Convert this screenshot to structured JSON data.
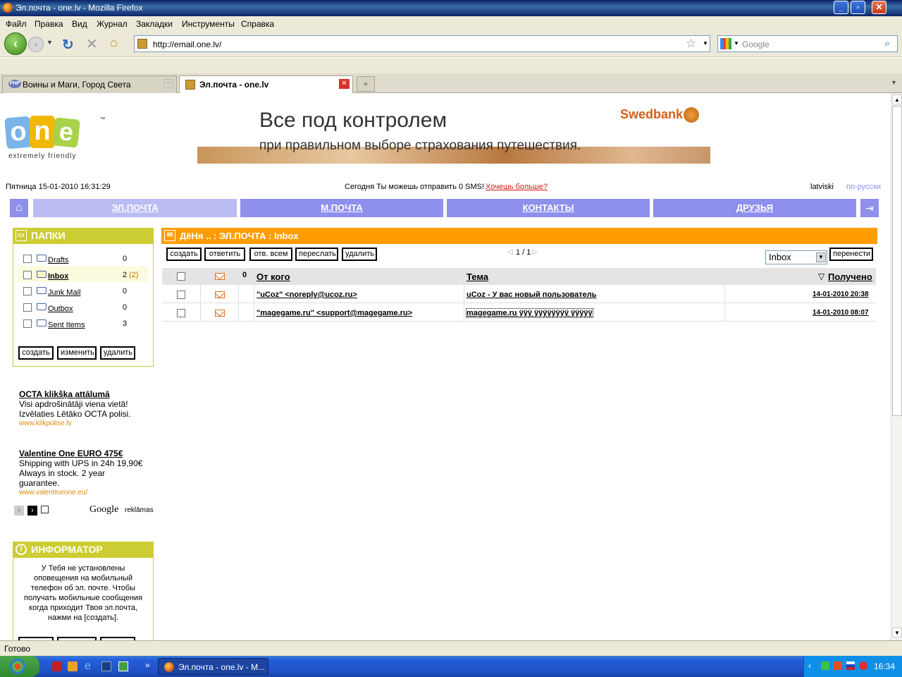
{
  "window": {
    "title": "Эл.почта - one.lv - Mozilla Firefox"
  },
  "menu": [
    "Файл",
    "Правка",
    "Вид",
    "Журнал",
    "Закладки",
    "Инструменты",
    "Справка"
  ],
  "nav": {
    "url": "http://email.one.lv/",
    "search_placeholder": "Google"
  },
  "tabs": [
    {
      "label": "Воины и Маги, Город Света",
      "icon": "php-icon"
    },
    {
      "label": "Эл.почта - one.lv",
      "icon": "page-icon"
    }
  ],
  "banner": {
    "logo": "one",
    "logo_tagline": "extremely friendly",
    "headline": "Все под контролем",
    "subline": "при правильном выборе страхования путешествия.",
    "brand": "Swedbank"
  },
  "infobar": {
    "datetime": "Пятница 15-01-2010 16:31:29",
    "sms_text": "Сегодня Ты можешь отправить 0 SMS!",
    "sms_link": "Хочешь больше?",
    "lang1": "latviski",
    "lang2": "по-русски"
  },
  "navtabs": [
    "ЭЛ.ПОЧТА",
    "М.ПОЧТА",
    "КОНТАКТЫ",
    "ДРУЗЬЯ"
  ],
  "folders_panel": {
    "title": "ПАПКИ",
    "items": [
      {
        "name": "Drafts",
        "count": "0",
        "unread": ""
      },
      {
        "name": "Inbox",
        "count": "2",
        "unread": "(2)"
      },
      {
        "name": "Junk Mail",
        "count": "0",
        "unread": ""
      },
      {
        "name": "Outbox",
        "count": "0",
        "unread": ""
      },
      {
        "name": "Sent Items",
        "count": "3",
        "unread": ""
      }
    ],
    "buttons": [
      "создать",
      "изменить",
      "удалить"
    ]
  },
  "ads": [
    {
      "title": "OCTA klikšķa attālumā",
      "line1": "Visi apdrošinātāji viena vietā!",
      "line2": "Izvēlaties Lētāko OCTA polisi.",
      "url": "www.klikpolise.lv"
    },
    {
      "title": "Valentine One EURO 475€",
      "line1": "Shipping with UPS in 24h 19,90€",
      "line2": "Always in stock. 2 year",
      "line3": "guarantee.",
      "url": "www.valentineone.eu/"
    }
  ],
  "ads_footer": {
    "google": "Google",
    "reklamas": "reklāmas"
  },
  "informer": {
    "title": "ИНФОРМАТОР",
    "text1": "У Тебя не установлены",
    "text2": "оповещения на мобильный",
    "text3": "телефон об эл. почте. Чтобы",
    "text4": "получать мобильные сообщения",
    "text5": "когда приходит Твоя эл.почта,",
    "text6": "нажми на [создать]."
  },
  "mail": {
    "header": "ДёНя .. : ЭЛ.ПОЧТА : Inbox",
    "toolbar": [
      "создать",
      "ответить",
      "отв. всем",
      "переслать",
      "удалить"
    ],
    "pager": "1 / 1",
    "folder_select": "Inbox",
    "move_button": "перенести",
    "columns": {
      "from": "От кого",
      "subject": "Тема",
      "received": "Получено",
      "sort_marker": "▽"
    },
    "rows": [
      {
        "from": "\"uCoz\" <noreply@ucoz.ru>",
        "subject": "uCoz - У вас новый пользователь",
        "date": "14-01-2010 20:38"
      },
      {
        "from": "\"magegame.ru\" <support@magegame.ru>",
        "subject": "magegame.ru ÿÿÿ ÿÿÿÿÿÿÿÿ ÿÿÿÿÿ",
        "date": "14-01-2010 08:07"
      }
    ]
  },
  "status": "Готово",
  "taskbar": {
    "item": "Эл.почта - one.lv - M...",
    "clock": "16:34",
    "more": "»"
  }
}
